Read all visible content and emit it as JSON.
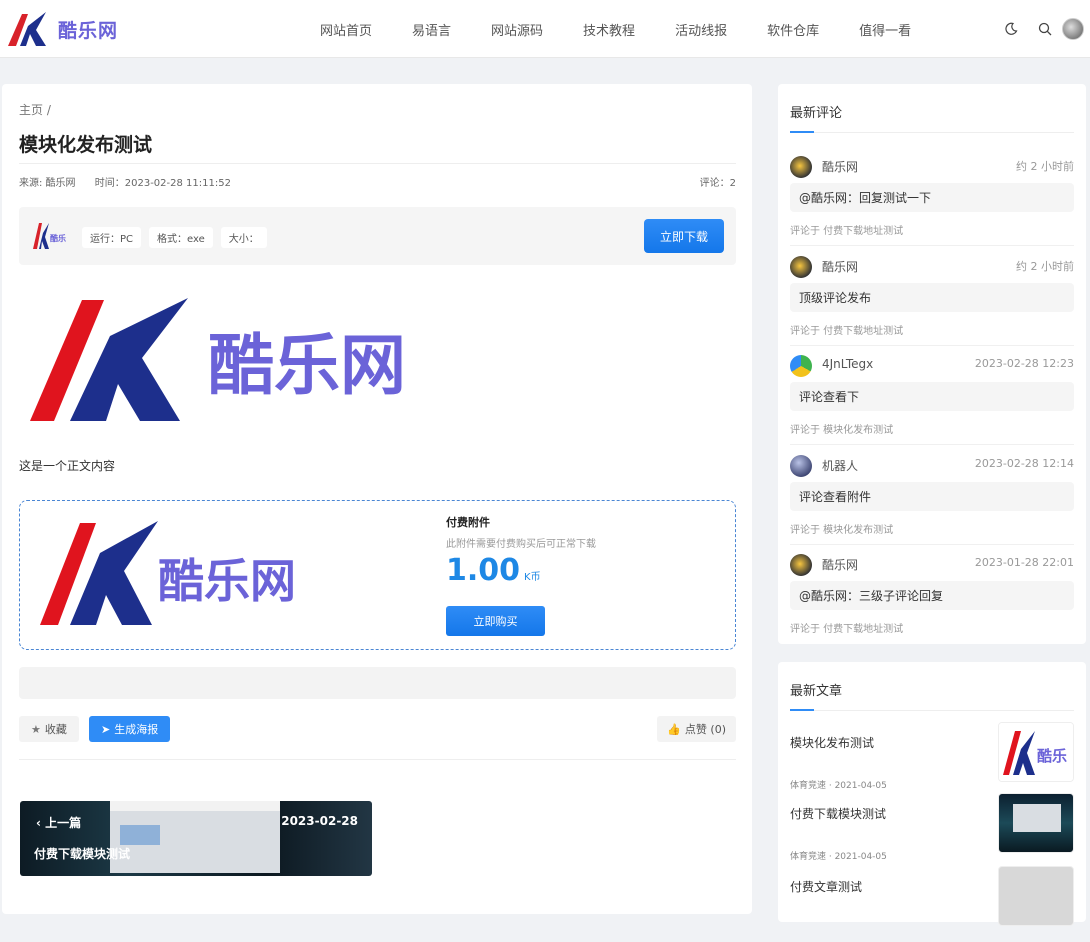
{
  "header": {
    "site_name": "酷乐网",
    "nav": [
      "网站首页",
      "易语言",
      "网站源码",
      "技术教程",
      "活动线报",
      "软件仓库",
      "值得一看"
    ]
  },
  "post": {
    "breadcrumb": "主页  /",
    "title": "模块化发布测试",
    "source": "来源: 酷乐网",
    "time": "时间：2023-02-28 11:11:52",
    "comments": "评论：2",
    "download": {
      "tags": [
        "运行：PC",
        "格式：exe",
        "大小："
      ],
      "button": "立即下载"
    },
    "body_text": "这是一个正文内容",
    "attachment": {
      "title": "付费附件",
      "desc": "此附件需要付费购买后可正常下载",
      "price": "1.00",
      "unit": "K币",
      "button": "立即购买"
    },
    "actions": {
      "favorite": "收藏",
      "poster": "生成海报",
      "like": "点赞 (0)"
    },
    "prev": {
      "label": "上一篇",
      "date": "2023-02-28",
      "title": "付费下载模块测试"
    }
  },
  "sidebar": {
    "comments_title": "最新评论",
    "comments": [
      {
        "name": "酷乐网",
        "time": "约 2 小时前",
        "text": "@酷乐网：回复测试一下",
        "src": "评论于 付费下载地址测试"
      },
      {
        "name": "酷乐网",
        "time": "约 2 小时前",
        "text": "顶级评论发布",
        "src": "评论于 付费下载地址测试"
      },
      {
        "name": "4JnLTegx",
        "time": "2023-02-28 12:23",
        "text": "评论查看下",
        "src": "评论于 模块化发布测试"
      },
      {
        "name": "机器人",
        "time": "2023-02-28 12:14",
        "text": "评论查看附件",
        "src": "评论于 模块化发布测试"
      },
      {
        "name": "酷乐网",
        "time": "2023-01-28 22:01",
        "text": "@酷乐网：三级子评论回复",
        "src": "评论于 付费下载地址测试"
      }
    ],
    "articles_title": "最新文章",
    "articles": [
      {
        "title": "模块化发布测试",
        "meta": "体育竞速 · 2021-04-05"
      },
      {
        "title": "付费下载模块测试",
        "meta": "体育竞速 · 2021-04-05"
      },
      {
        "title": "付费文章测试",
        "meta": ""
      }
    ]
  }
}
